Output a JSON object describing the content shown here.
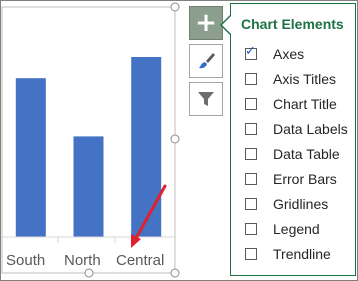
{
  "panel": {
    "title": "Chart Elements",
    "options": [
      {
        "label": "Axes",
        "checked": true
      },
      {
        "label": "Axis Titles",
        "checked": false
      },
      {
        "label": "Chart Title",
        "checked": false
      },
      {
        "label": "Data Labels",
        "checked": false
      },
      {
        "label": "Data Table",
        "checked": false
      },
      {
        "label": "Error Bars",
        "checked": false
      },
      {
        "label": "Gridlines",
        "checked": false
      },
      {
        "label": "Legend",
        "checked": false
      },
      {
        "label": "Trendline",
        "checked": false
      }
    ]
  },
  "tools": {
    "elements_icon": "plus-icon",
    "styles_icon": "paintbrush-icon",
    "filters_icon": "filter-icon"
  },
  "chart_data": {
    "type": "bar",
    "categories": [
      "South",
      "North",
      "Central"
    ],
    "values": [
      60,
      38,
      68
    ],
    "ylim": [
      0,
      85
    ],
    "grid": false,
    "bar_color": "#4472c4"
  },
  "annotation_color": "#e0202e"
}
